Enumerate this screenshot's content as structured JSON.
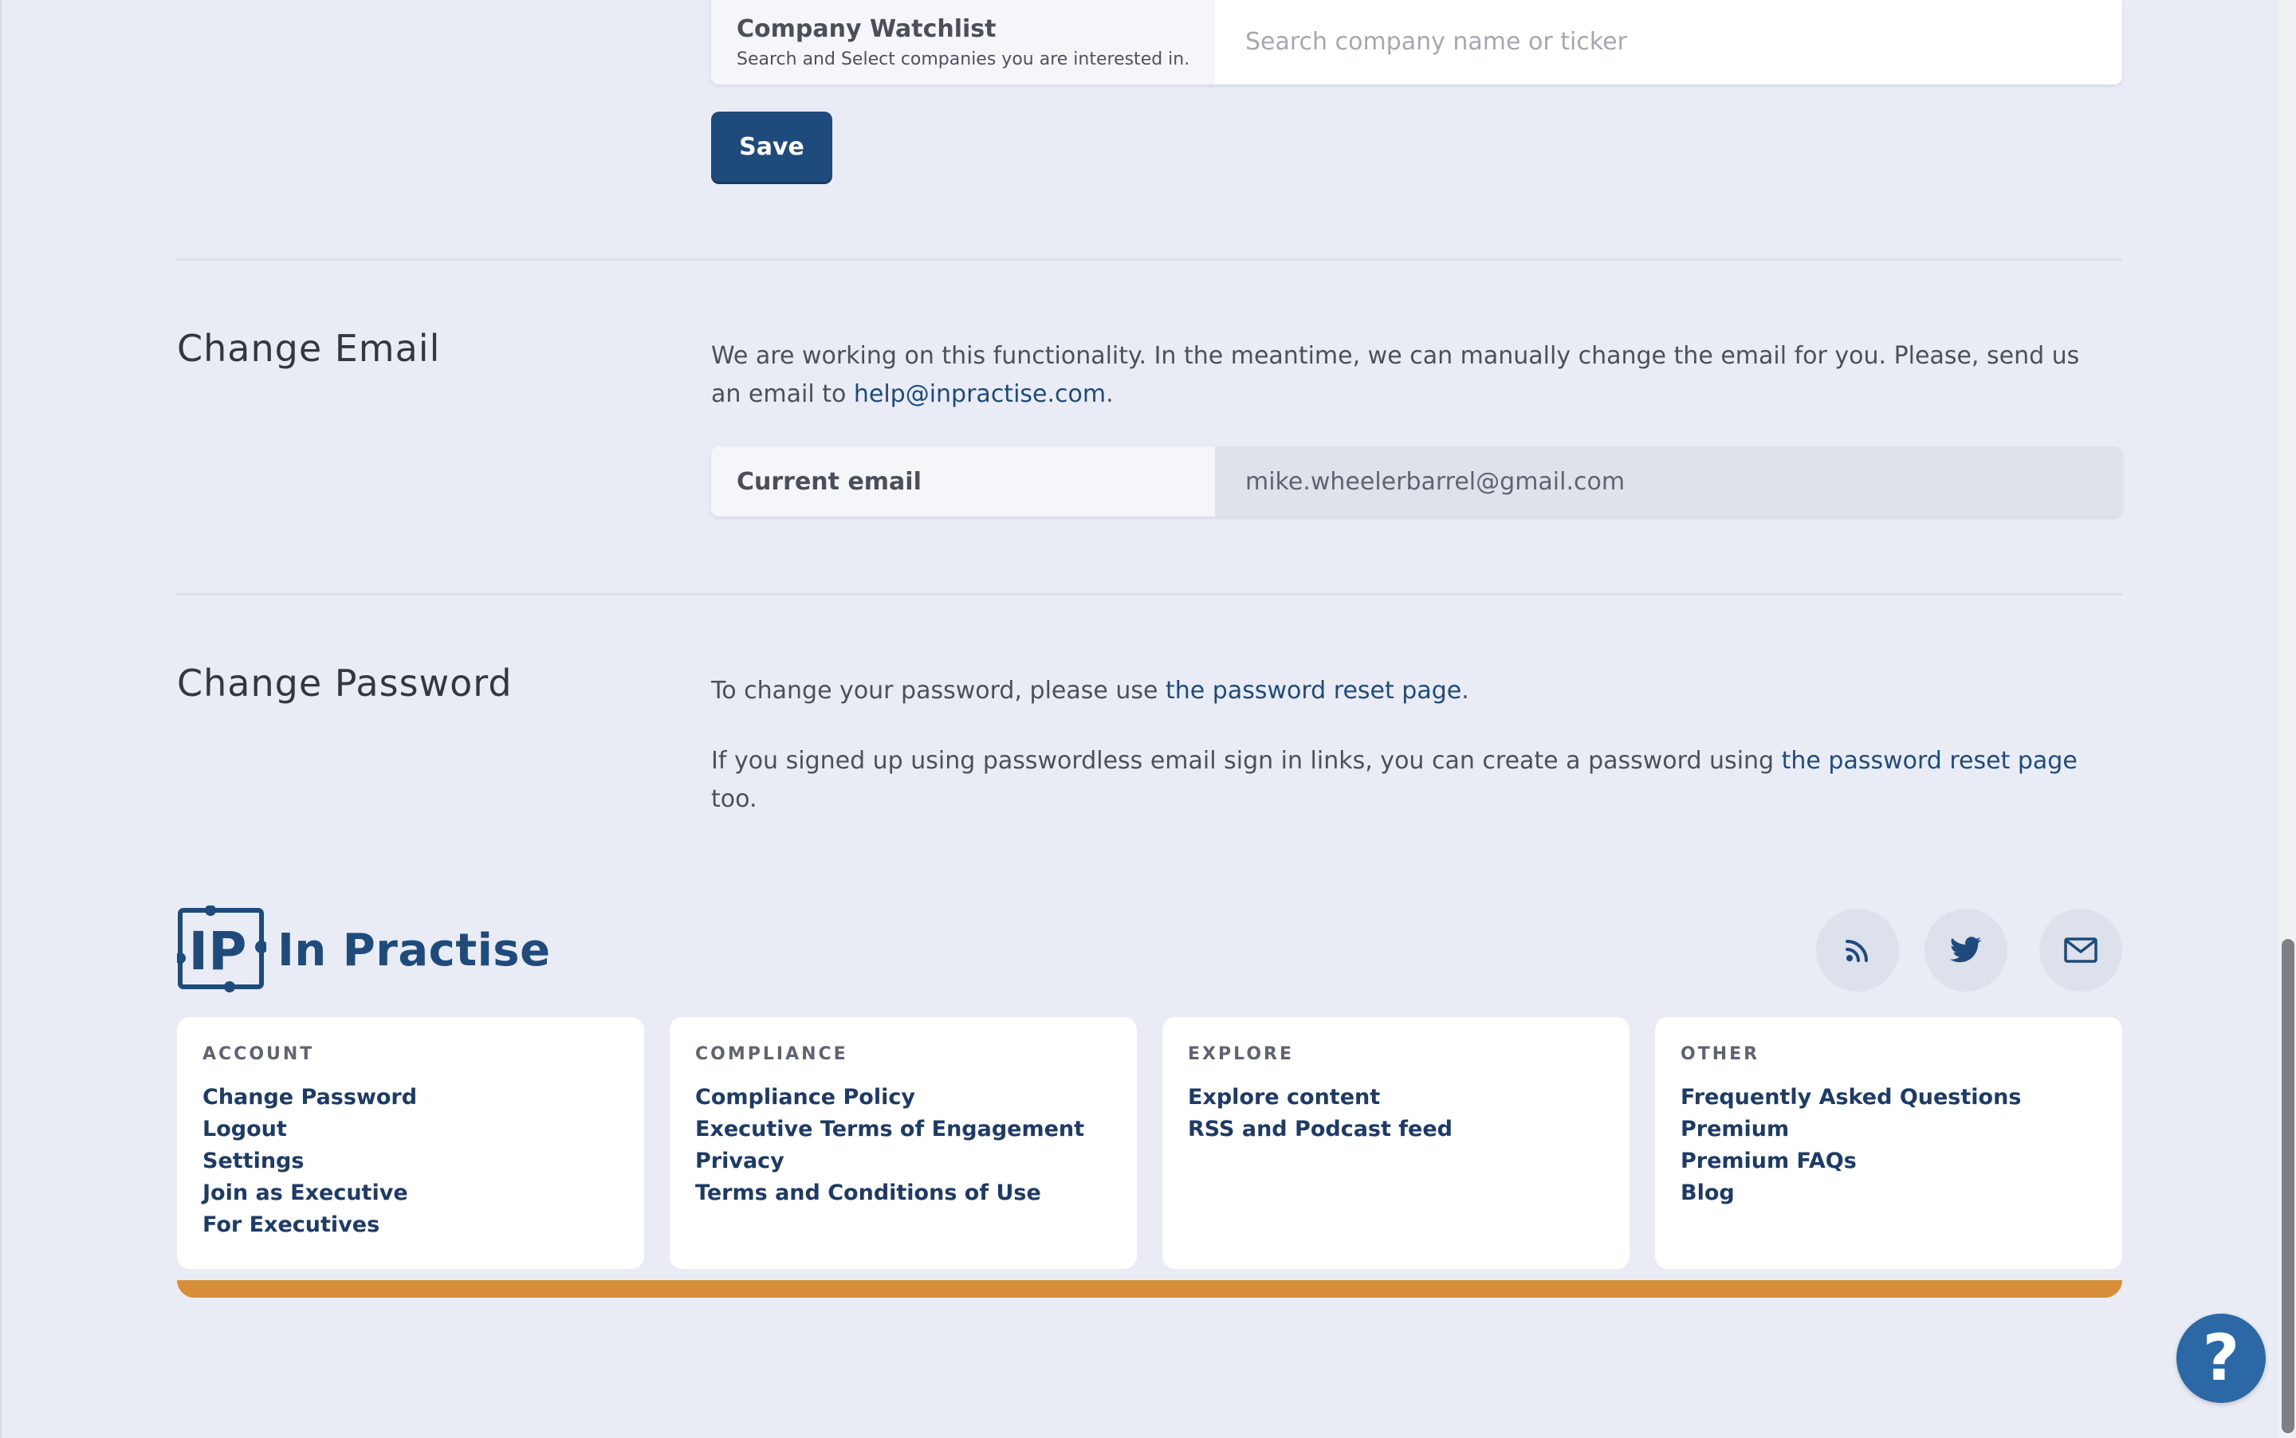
{
  "watchlist": {
    "title": "Company Watchlist",
    "subtitle": "Search and Select companies you are interested in.",
    "placeholder": "Search company name or ticker",
    "save_label": "Save"
  },
  "change_email": {
    "title": "Change Email",
    "text_before": "We are working on this functionality. In the meantime, we can manually change the email for you. Please, send us an email to ",
    "email_link": "help@inpractise.com",
    "text_after": ".",
    "current_label": "Current email",
    "current_value": "mike.wheelerbarrel@gmail.com"
  },
  "change_password": {
    "title": "Change Password",
    "line1_before": "To change your password, please use ",
    "line1_link": "the password reset page",
    "line1_after": ".",
    "line2_before": "If you signed up using passwordless email sign in links, you can create a password using ",
    "line2_link": "the password reset page",
    "line2_after": " too."
  },
  "footer": {
    "brand": "In Practise",
    "logo_mark": "IP",
    "social_icons": [
      "rss-icon",
      "twitter-icon",
      "mail-icon"
    ],
    "columns": [
      {
        "heading": "ACCOUNT",
        "links": [
          "Change Password",
          "Logout",
          "Settings",
          "Join as Executive",
          "For Executives"
        ]
      },
      {
        "heading": "COMPLIANCE",
        "links": [
          "Compliance Policy",
          "Executive Terms of Engagement",
          "Privacy",
          "Terms and Conditions of Use"
        ]
      },
      {
        "heading": "EXPLORE",
        "links": [
          "Explore content",
          "RSS and Podcast feed"
        ]
      },
      {
        "heading": "OTHER",
        "links": [
          "Frequently Asked Questions",
          "Premium",
          "Premium FAQs",
          "Blog"
        ]
      }
    ]
  },
  "help_button": "?",
  "colors": {
    "background": "#e9ecf4",
    "primary": "#1f4a7c",
    "accent_bar": "#d68e38",
    "help_button": "#2c68a6"
  }
}
